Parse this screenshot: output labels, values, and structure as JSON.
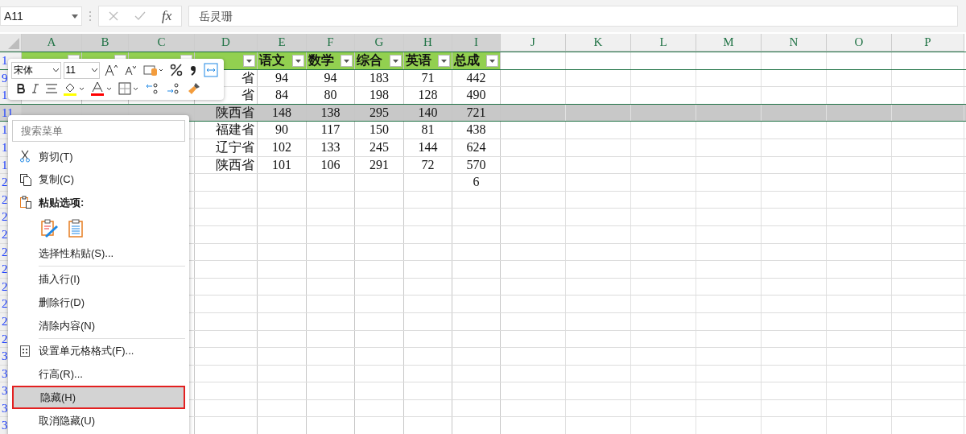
{
  "formula_bar": {
    "name_box": "A11",
    "fx_label": "fx",
    "value": "岳灵珊"
  },
  "columns": [
    {
      "letter": "A",
      "highlighted": true,
      "filter": true
    },
    {
      "letter": "B",
      "highlighted": true,
      "filter": true
    },
    {
      "letter": "C",
      "highlighted": true,
      "filter": true
    },
    {
      "letter": "D",
      "highlighted": true,
      "filter": true
    },
    {
      "letter": "E",
      "highlighted": true,
      "filter": true
    },
    {
      "letter": "F",
      "highlighted": true,
      "filter": true
    },
    {
      "letter": "G",
      "highlighted": true,
      "filter": true
    },
    {
      "letter": "H",
      "highlighted": true,
      "filter": true
    },
    {
      "letter": "I",
      "highlighted": true,
      "filter": true
    },
    {
      "letter": "J",
      "highlighted": false,
      "filter": false
    },
    {
      "letter": "K",
      "highlighted": false,
      "filter": false
    },
    {
      "letter": "L",
      "highlighted": false,
      "filter": false
    },
    {
      "letter": "M",
      "highlighted": false,
      "filter": false
    },
    {
      "letter": "N",
      "highlighted": false,
      "filter": false
    },
    {
      "letter": "O",
      "highlighted": false,
      "filter": false
    },
    {
      "letter": "P",
      "highlighted": false,
      "filter": false
    }
  ],
  "header_row": {
    "number": "1",
    "cells": {
      "E": "语文",
      "F": "数学",
      "G": "综合",
      "H": "英语",
      "I": "总成"
    }
  },
  "rows": [
    {
      "number": "9",
      "selected": false,
      "cells": {
        "D": "省",
        "E": "94",
        "F": "94",
        "G": "183",
        "H": "71",
        "I": "442"
      }
    },
    {
      "number": "1",
      "selected": false,
      "cells": {
        "D": "省",
        "E": "84",
        "F": "80",
        "G": "198",
        "H": "128",
        "I": "490"
      }
    },
    {
      "number": "11",
      "selected": true,
      "cells": {
        "D": "陕西省",
        "E": "148",
        "F": "138",
        "G": "295",
        "H": "140",
        "I": "721"
      }
    },
    {
      "number": "1",
      "selected": false,
      "cells": {
        "D": "福建省",
        "E": "90",
        "F": "117",
        "G": "150",
        "H": "81",
        "I": "438"
      }
    },
    {
      "number": "1",
      "selected": false,
      "cells": {
        "D": "辽宁省",
        "E": "102",
        "F": "133",
        "G": "245",
        "H": "144",
        "I": "624"
      }
    },
    {
      "number": "1",
      "selected": false,
      "cells": {
        "D": "陕西省",
        "E": "101",
        "F": "106",
        "G": "291",
        "H": "72",
        "I": "570"
      }
    },
    {
      "number": "2",
      "selected": false,
      "cells": {
        "I": "6"
      }
    },
    {
      "number": "2",
      "selected": false,
      "cells": {}
    },
    {
      "number": "2",
      "selected": false,
      "cells": {}
    },
    {
      "number": "2",
      "selected": false,
      "cells": {}
    },
    {
      "number": "2",
      "selected": false,
      "cells": {}
    },
    {
      "number": "2",
      "selected": false,
      "cells": {}
    },
    {
      "number": "2",
      "selected": false,
      "cells": {}
    },
    {
      "number": "2",
      "selected": false,
      "cells": {}
    },
    {
      "number": "2",
      "selected": false,
      "cells": {}
    },
    {
      "number": "2",
      "selected": false,
      "cells": {}
    },
    {
      "number": "3",
      "selected": false,
      "cells": {}
    },
    {
      "number": "3",
      "selected": false,
      "cells": {}
    },
    {
      "number": "3",
      "selected": false,
      "cells": {}
    },
    {
      "number": "3",
      "selected": false,
      "cells": {}
    },
    {
      "number": "3",
      "selected": false,
      "cells": {}
    }
  ],
  "mini_toolbar": {
    "font": "宋体",
    "size": "11"
  },
  "context_menu": {
    "search_placeholder": "搜索菜单",
    "items": [
      {
        "kind": "cut",
        "label": "剪切(T)",
        "selected": false
      },
      {
        "kind": "copy",
        "label": "复制(C)",
        "selected": false
      },
      {
        "kind": "header",
        "label": "粘贴选项:"
      },
      {
        "kind": "paste_icons"
      },
      {
        "kind": "item",
        "label": "选择性粘贴(S)...",
        "selected": false
      },
      {
        "kind": "divider"
      },
      {
        "kind": "item",
        "label": "插入行(I)",
        "selected": false
      },
      {
        "kind": "item",
        "label": "删除行(D)",
        "selected": false
      },
      {
        "kind": "item",
        "label": "清除内容(N)",
        "selected": false
      },
      {
        "kind": "divider"
      },
      {
        "kind": "format",
        "label": "设置单元格格式(F)...",
        "selected": false
      },
      {
        "kind": "item",
        "label": "行高(R)...",
        "selected": false
      },
      {
        "kind": "item",
        "label": "隐藏(H)",
        "selected": true
      },
      {
        "kind": "item",
        "label": "取消隐藏(U)",
        "selected": false
      }
    ]
  }
}
